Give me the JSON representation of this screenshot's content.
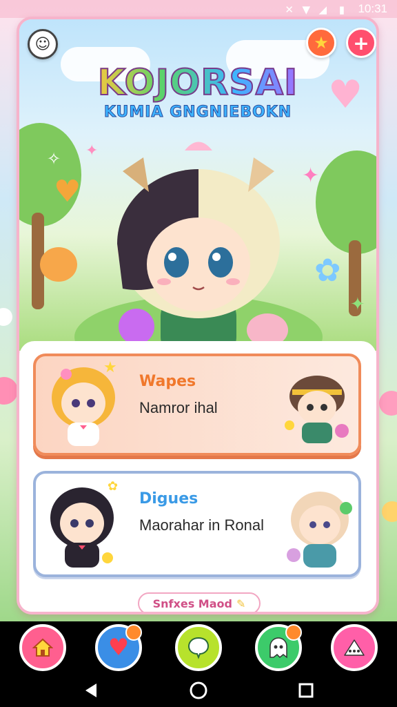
{
  "status_bar": {
    "time": "10:31"
  },
  "header": {
    "title": "KOJORSAI",
    "subtitle": "KUMIA GNGNIEBOKN"
  },
  "top_buttons": [
    {
      "icon": "star-icon"
    },
    {
      "icon": "plus-icon"
    }
  ],
  "options": [
    {
      "title": "Wapes",
      "subtitle": "Namror ihal",
      "accent": "#f08b5a"
    },
    {
      "title": "Digues",
      "subtitle": "Maorahar in Ronal",
      "accent": "#9bb3dc"
    }
  ],
  "mood_button": {
    "label": "Snfxes Maod"
  },
  "bottom_nav": [
    {
      "icon": "home-icon",
      "color": "#ff5f8f"
    },
    {
      "icon": "heart-icon",
      "color": "#3a8ee6"
    },
    {
      "icon": "chat-icon",
      "color": "#b7e22c"
    },
    {
      "icon": "ghost-icon",
      "color": "#3ccb6a"
    },
    {
      "icon": "more-icon",
      "color": "#ff5fa8"
    }
  ],
  "system_nav": [
    {
      "icon": "back-icon"
    },
    {
      "icon": "home-circle-icon"
    },
    {
      "icon": "recents-icon"
    }
  ]
}
